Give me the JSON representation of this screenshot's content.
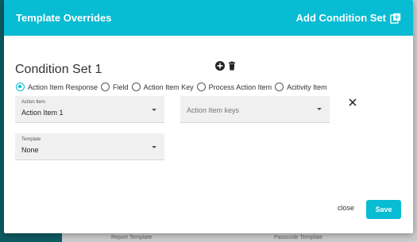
{
  "modal": {
    "title": "Template Overrides",
    "add_label": "Add Condition Set",
    "condition_set_title": "Condition Set 1",
    "radio_options": [
      {
        "label": "Action Item Response",
        "selected": true
      },
      {
        "label": "Field",
        "selected": false
      },
      {
        "label": "Action Item Key",
        "selected": false
      },
      {
        "label": "Process Action Item",
        "selected": false
      },
      {
        "label": "Acitivity Item",
        "selected": false
      }
    ],
    "action_item_select": {
      "label": "Action Item",
      "value": "Action Item 1"
    },
    "action_item_keys_select": {
      "placeholder": "Action Item keys"
    },
    "template_select": {
      "label": "Template",
      "value": "None"
    },
    "close_label": "close",
    "save_label": "Save"
  },
  "background": {
    "label_left": "Report Template",
    "label_right": "Passcode Template"
  },
  "colors": {
    "accent": "#08bcd3",
    "sidebar": "#0f5d64"
  },
  "icons": [
    "library-add-icon",
    "add-circle-icon",
    "trash-icon",
    "close-icon",
    "chevron-down-icon"
  ]
}
